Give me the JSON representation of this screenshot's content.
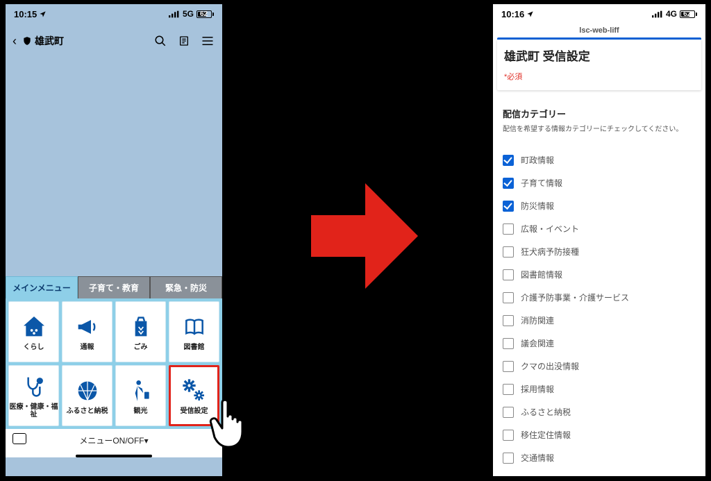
{
  "left": {
    "status": {
      "time": "10:15",
      "network": "5G",
      "battery": "62"
    },
    "header": {
      "title": "雄武町"
    },
    "tabs": [
      "メインメニュー",
      "子育て・教育",
      "緊急・防災"
    ],
    "tiles": [
      {
        "label": "くらし"
      },
      {
        "label": "通報"
      },
      {
        "label": "ごみ"
      },
      {
        "label": "図書館"
      },
      {
        "label": "医療・健康・福祉"
      },
      {
        "label": "ふるさと納税"
      },
      {
        "label": "観光"
      },
      {
        "label": "受信設定"
      }
    ],
    "menu_toggle": "メニューON/OFF▾"
  },
  "right": {
    "status": {
      "time": "10:16",
      "network": "4G",
      "battery": "62"
    },
    "mini_title": "lsc-web-liff",
    "card_title": "雄武町 受信設定",
    "required": "*必須",
    "section_title": "配信カテゴリー",
    "section_desc": "配信を希望する情報カテゴリーにチェックしてください。",
    "items": [
      {
        "label": "町政情報",
        "checked": true
      },
      {
        "label": "子育て情報",
        "checked": true
      },
      {
        "label": "防災情報",
        "checked": true
      },
      {
        "label": "広報・イベント",
        "checked": false
      },
      {
        "label": "狂犬病予防接種",
        "checked": false
      },
      {
        "label": "図書館情報",
        "checked": false
      },
      {
        "label": "介護予防事業・介護サービス",
        "checked": false
      },
      {
        "label": "消防関連",
        "checked": false
      },
      {
        "label": "議会関連",
        "checked": false
      },
      {
        "label": "クマの出没情報",
        "checked": false
      },
      {
        "label": "採用情報",
        "checked": false
      },
      {
        "label": "ふるさと納税",
        "checked": false
      },
      {
        "label": "移住定住情報",
        "checked": false
      },
      {
        "label": "交通情報",
        "checked": false
      }
    ]
  }
}
